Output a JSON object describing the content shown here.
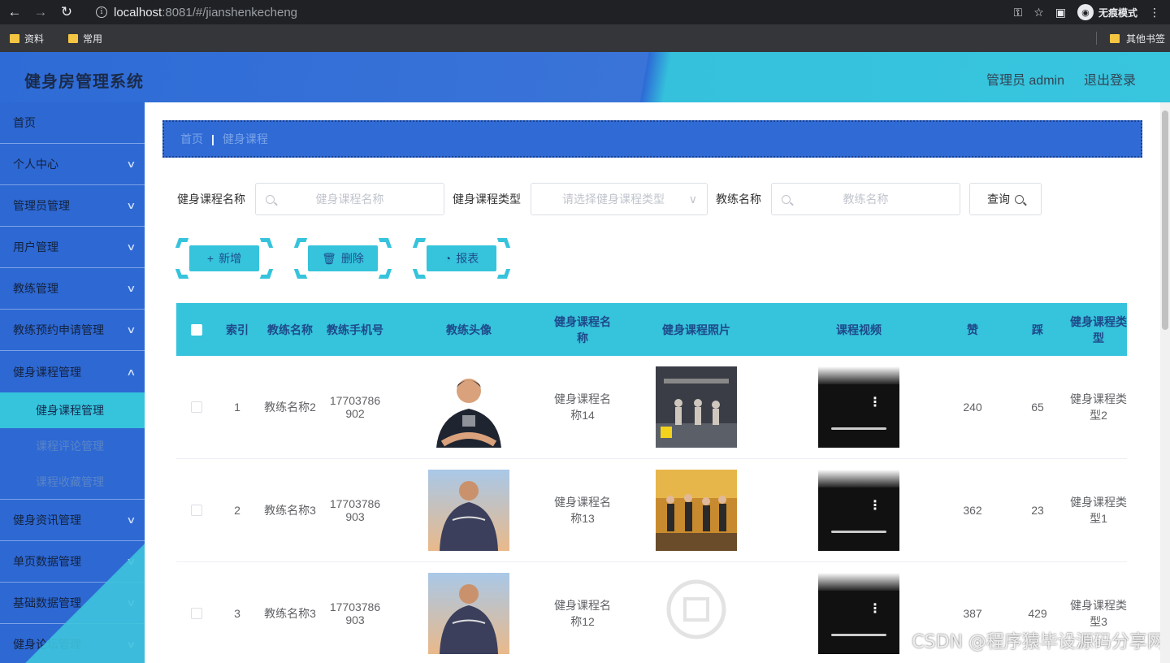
{
  "browser": {
    "url_host": "localhost",
    "url_rest": ":8081/#/jianshenkecheng",
    "incognito_label": "无痕模式",
    "bookmarks": [
      "资料",
      "常用"
    ],
    "other_bookmarks": "其他书签"
  },
  "header": {
    "title": "健身房管理系统",
    "user": "管理员 admin",
    "logout": "退出登录"
  },
  "sidebar": {
    "items": [
      {
        "label": "首页"
      },
      {
        "label": "个人中心"
      },
      {
        "label": "管理员管理"
      },
      {
        "label": "用户管理"
      },
      {
        "label": "教练管理"
      },
      {
        "label": "教练预约申请管理"
      },
      {
        "label": "健身课程管理"
      }
    ],
    "sub_items": [
      {
        "label": "健身课程管理"
      },
      {
        "label": "课程评论管理"
      },
      {
        "label": "课程收藏管理"
      }
    ],
    "items_after": [
      {
        "label": "健身资讯管理"
      },
      {
        "label": "单页数据管理"
      },
      {
        "label": "基础数据管理"
      },
      {
        "label": "健身论坛管理"
      }
    ]
  },
  "breadcrumb": {
    "home": "首页",
    "sep": "|",
    "current": "健身课程"
  },
  "filters": {
    "course_name_label": "健身课程名称",
    "course_name_placeholder": "健身课程名称",
    "course_type_label": "健身课程类型",
    "course_type_placeholder": "请选择健身课程类型",
    "coach_name_label": "教练名称",
    "coach_name_placeholder": "教练名称",
    "query_label": "查询"
  },
  "actions": {
    "add": "新增",
    "delete": "删除",
    "report": "报表"
  },
  "table": {
    "headers": [
      "索引",
      "教练名称",
      "教练手机号",
      "教练头像",
      "健身课程名称",
      "健身课程照片",
      "课程视频",
      "赞",
      "踩",
      "健身课程类型"
    ],
    "rows": [
      {
        "index": "1",
        "coach": "教练名称2",
        "phone": "17703786902",
        "course": "健身课程名称14",
        "likes": "240",
        "dislikes": "65",
        "type": "健身课程类型2"
      },
      {
        "index": "2",
        "coach": "教练名称3",
        "phone": "17703786903",
        "course": "健身课程名称13",
        "likes": "362",
        "dislikes": "23",
        "type": "健身课程类型1"
      },
      {
        "index": "3",
        "coach": "教练名称3",
        "phone": "17703786903",
        "course": "健身课程名称12",
        "likes": "387",
        "dislikes": "429",
        "type": "健身课程类型3"
      }
    ]
  },
  "watermark": "CSDN @程序猿毕设源码分享网",
  "colors": {
    "primary": "#2f69d4",
    "accent": "#36c3dc"
  }
}
